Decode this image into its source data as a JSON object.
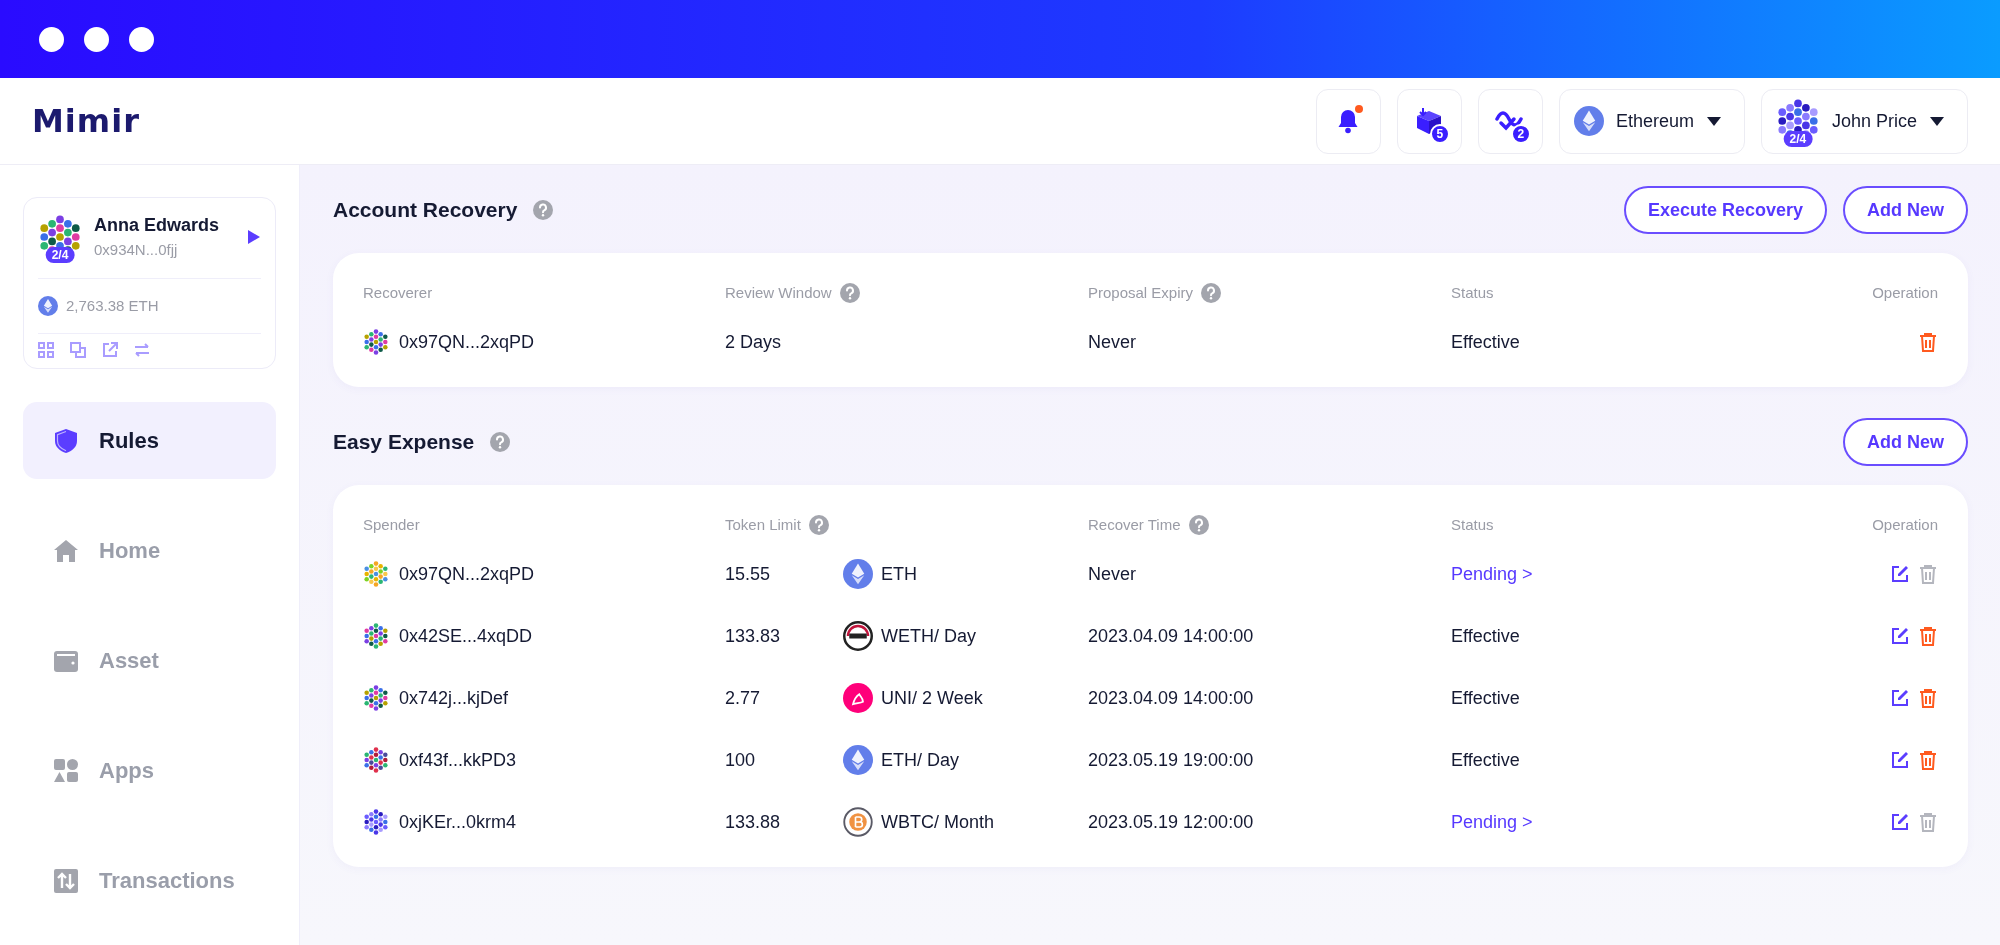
{
  "app": {
    "logo": "Mimir"
  },
  "header": {
    "notifications": {
      "unread": true
    },
    "queue_buttons": [
      {
        "kind": "pending-box",
        "count": "5"
      },
      {
        "kind": "signature",
        "count": "2"
      }
    ],
    "network": {
      "name": "Ethereum"
    },
    "user": {
      "name": "John Price",
      "threshold": "2/4"
    }
  },
  "account_card": {
    "name": "Anna Edwards",
    "address": "0x934N...0fjj",
    "threshold": "2/4",
    "balance": "2,763.38 ETH"
  },
  "sidebar": {
    "items": [
      {
        "kind": "rules",
        "label": "Rules",
        "selected": true
      },
      {
        "kind": "home",
        "label": "Home",
        "selected": false
      },
      {
        "kind": "asset",
        "label": "Asset",
        "selected": false
      },
      {
        "kind": "apps",
        "label": "Apps",
        "selected": false
      },
      {
        "kind": "transactions",
        "label": "Transactions",
        "selected": false
      }
    ]
  },
  "account_recovery": {
    "title": "Account Recovery",
    "buttons": [
      "Execute Recovery",
      "Add New"
    ],
    "columns": [
      {
        "label": "Recoverer",
        "help": false
      },
      {
        "label": "Review Window",
        "help": true
      },
      {
        "label": "Proposal Expiry",
        "help": true
      },
      {
        "label": "Status",
        "help": false
      },
      {
        "label": "Operation",
        "help": false
      }
    ],
    "rows": [
      {
        "recoverer": "0x97QN...2xqPD",
        "review_window": "2 Days",
        "proposal_expiry": "Never",
        "status": "Effective",
        "pending": false,
        "delete_enabled": true
      }
    ]
  },
  "easy_expense": {
    "title": "Easy Expense",
    "buttons": [
      "Add New"
    ],
    "columns": [
      {
        "label": "Spender",
        "help": false
      },
      {
        "label": "Token Limit",
        "help": true
      },
      {
        "label": "Recover Time",
        "help": true
      },
      {
        "label": "Status",
        "help": false
      },
      {
        "label": "Operation",
        "help": false
      }
    ],
    "rows": [
      {
        "spender": "0x97QN...2xqPD",
        "amount": "15.55",
        "kind": "eth",
        "token_label": "ETH",
        "recover_time": "Never",
        "status": "Pending >",
        "pending": true,
        "delete_enabled": false
      },
      {
        "spender": "0x42SE...4xqDD",
        "amount": "133.83",
        "kind": "weth",
        "token_label": "WETH/ Day",
        "recover_time": "2023.04.09 14:00:00",
        "status": "Effective",
        "pending": false,
        "delete_enabled": true
      },
      {
        "spender": "0x742j...kjDef",
        "amount": "2.77",
        "kind": "uni",
        "token_label": "UNI/ 2 Week",
        "recover_time": "2023.04.09 14:00:00",
        "status": "Effective",
        "pending": false,
        "delete_enabled": true
      },
      {
        "spender": "0xf43f...kkPD3",
        "amount": "100",
        "kind": "eth",
        "token_label": "ETH/ Day",
        "recover_time": "2023.05.19 19:00:00",
        "status": "Effective",
        "pending": false,
        "delete_enabled": true
      },
      {
        "spender": "0xjKEr...0krm4",
        "amount": "133.88",
        "kind": "wbtc",
        "token_label": "WBTC/ Month",
        "recover_time": "2023.05.19 12:00:00",
        "status": "Pending >",
        "pending": true,
        "delete_enabled": false
      }
    ]
  }
}
